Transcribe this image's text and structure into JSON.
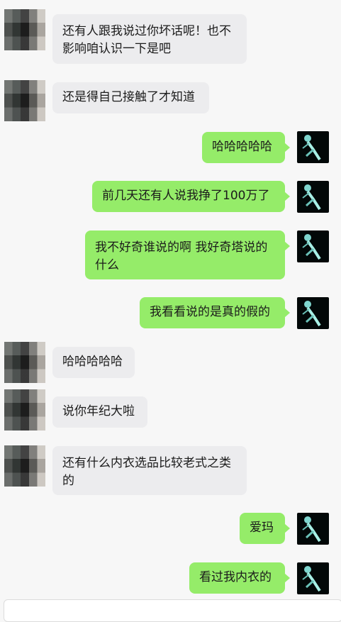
{
  "messages": [
    {
      "side": "in",
      "text": "还有人跟我说过你坏话呢！也不\n影响咱认识一下是吧"
    },
    {
      "side": "in",
      "text": "还是得自己接触了才知道"
    },
    {
      "side": "out",
      "text": "哈哈哈哈哈"
    },
    {
      "side": "out",
      "text": "前几天还有人说我挣了100万了"
    },
    {
      "side": "out",
      "text": "我不好奇谁说的啊 我好奇塔说的\n什么"
    },
    {
      "side": "out",
      "text": "我看看说的是真的假的"
    },
    {
      "side": "in",
      "text": "哈哈哈哈哈"
    },
    {
      "side": "in",
      "text": "说你年纪大啦"
    },
    {
      "side": "in",
      "text": "还有什么内衣选品比较老式之类\n的"
    },
    {
      "side": "out",
      "text": "爱玛"
    },
    {
      "side": "out",
      "text": "看过我内衣的"
    }
  ],
  "colors": {
    "incoming": "#ececee",
    "outgoing": "#95ec69",
    "background": "#f7f7f7"
  }
}
